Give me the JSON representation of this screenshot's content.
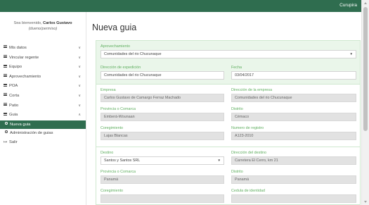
{
  "topbar": {
    "user": "Curupira"
  },
  "sidebar": {
    "welcome_prefix": "Sea bienvenido,",
    "welcome_name": "Carlos Gustavo",
    "role": "(dueno/permiso)",
    "items": [
      {
        "label": "Mis datos",
        "chevron": "∨"
      },
      {
        "label": "Vincular regente",
        "chevron": "∨"
      },
      {
        "label": "Equipo",
        "chevron": "∨"
      },
      {
        "label": "Aprovechamiento",
        "chevron": "∨"
      },
      {
        "label": "POA",
        "chevron": "∨"
      },
      {
        "label": "Corta",
        "chevron": "∨"
      },
      {
        "label": "Patio",
        "chevron": "∨"
      },
      {
        "label": "Guia",
        "chevron": "∧"
      }
    ],
    "subitems": [
      {
        "label": "Nueva guia"
      },
      {
        "label": "Administración de guias"
      }
    ],
    "logout": "Salir"
  },
  "main": {
    "title": "Nueva guia",
    "form": {
      "aprovechamiento": {
        "label": "Aprovechamiento",
        "value": "Comunidades del rio Chucunaque"
      },
      "direccion_expedicion": {
        "label": "Dirección de expedición",
        "value": "Comunidades del rio Chucunaque"
      },
      "fecha": {
        "label": "Fecha",
        "value": "03/04/2017"
      },
      "empresa": {
        "label": "Empresa",
        "value": "Carlos Gustavo de Camargo Ferraz Machado"
      },
      "direccion_empresa": {
        "label": "Dirección de la empresa",
        "value": "Comunidades del rio Chucunaque"
      },
      "provincia1": {
        "label": "Provincia o Comarca",
        "value": "Emberá-Wounaan"
      },
      "distrito1": {
        "label": "Distrito",
        "value": "Cémaco"
      },
      "corregimiento1": {
        "label": "Coregimiento",
        "value": "Lajas Blancas"
      },
      "numero_registro": {
        "label": "Numero de registro",
        "value": "A123-2010"
      },
      "destino": {
        "label": "Destino",
        "value": "Santos y Santos SRL"
      },
      "direccion_destino": {
        "label": "Dirección del destino",
        "value": "Carretera El Cerro, km 21"
      },
      "provincia2": {
        "label": "Provincia o Comarca",
        "value": "Panamá"
      },
      "distrito2": {
        "label": "Distrito",
        "value": "Panamá"
      },
      "corregimiento2": {
        "label": "Coregimiento"
      },
      "cedula": {
        "label": "Cedula de identidad"
      }
    }
  },
  "colors": {
    "brand": "#2f6d4f",
    "label_green": "#5fae5f",
    "panel_tint": "#eaf6ea"
  }
}
